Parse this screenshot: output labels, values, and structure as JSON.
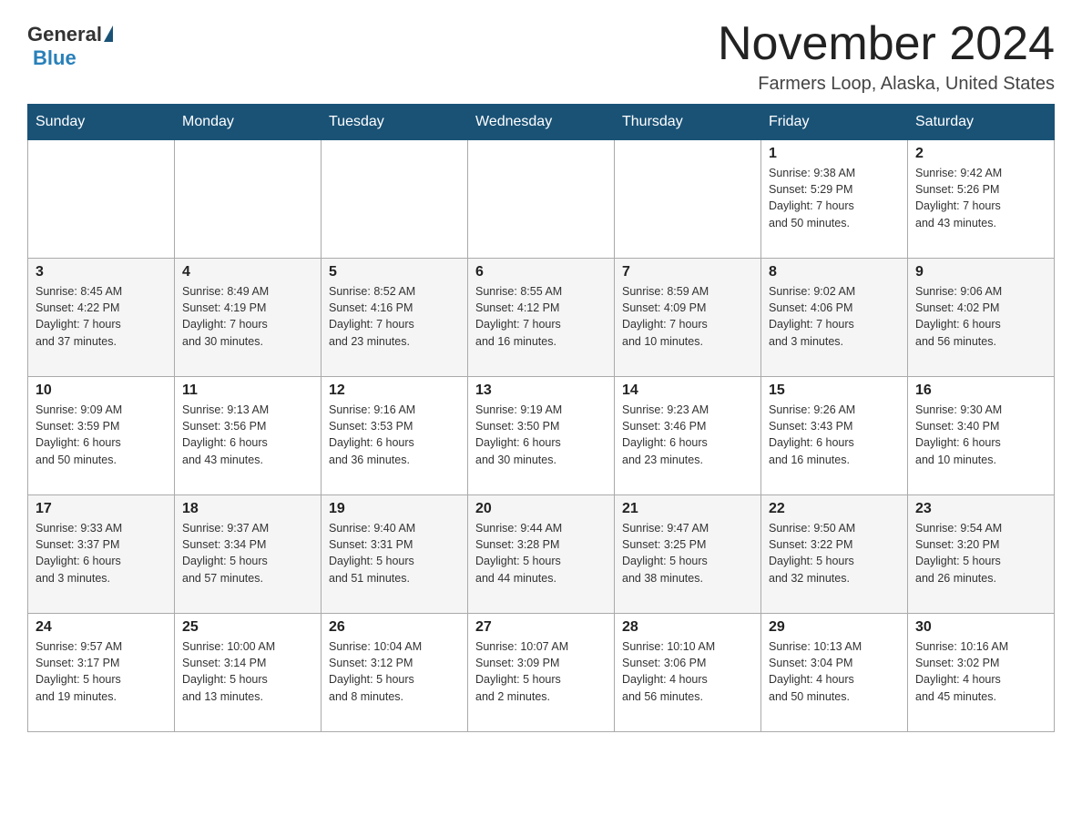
{
  "header": {
    "logo_general": "General",
    "logo_blue": "Blue",
    "title": "November 2024",
    "location": "Farmers Loop, Alaska, United States"
  },
  "days_of_week": [
    "Sunday",
    "Monday",
    "Tuesday",
    "Wednesday",
    "Thursday",
    "Friday",
    "Saturday"
  ],
  "weeks": [
    [
      {
        "day": "",
        "info": ""
      },
      {
        "day": "",
        "info": ""
      },
      {
        "day": "",
        "info": ""
      },
      {
        "day": "",
        "info": ""
      },
      {
        "day": "",
        "info": ""
      },
      {
        "day": "1",
        "info": "Sunrise: 9:38 AM\nSunset: 5:29 PM\nDaylight: 7 hours\nand 50 minutes."
      },
      {
        "day": "2",
        "info": "Sunrise: 9:42 AM\nSunset: 5:26 PM\nDaylight: 7 hours\nand 43 minutes."
      }
    ],
    [
      {
        "day": "3",
        "info": "Sunrise: 8:45 AM\nSunset: 4:22 PM\nDaylight: 7 hours\nand 37 minutes."
      },
      {
        "day": "4",
        "info": "Sunrise: 8:49 AM\nSunset: 4:19 PM\nDaylight: 7 hours\nand 30 minutes."
      },
      {
        "day": "5",
        "info": "Sunrise: 8:52 AM\nSunset: 4:16 PM\nDaylight: 7 hours\nand 23 minutes."
      },
      {
        "day": "6",
        "info": "Sunrise: 8:55 AM\nSunset: 4:12 PM\nDaylight: 7 hours\nand 16 minutes."
      },
      {
        "day": "7",
        "info": "Sunrise: 8:59 AM\nSunset: 4:09 PM\nDaylight: 7 hours\nand 10 minutes."
      },
      {
        "day": "8",
        "info": "Sunrise: 9:02 AM\nSunset: 4:06 PM\nDaylight: 7 hours\nand 3 minutes."
      },
      {
        "day": "9",
        "info": "Sunrise: 9:06 AM\nSunset: 4:02 PM\nDaylight: 6 hours\nand 56 minutes."
      }
    ],
    [
      {
        "day": "10",
        "info": "Sunrise: 9:09 AM\nSunset: 3:59 PM\nDaylight: 6 hours\nand 50 minutes."
      },
      {
        "day": "11",
        "info": "Sunrise: 9:13 AM\nSunset: 3:56 PM\nDaylight: 6 hours\nand 43 minutes."
      },
      {
        "day": "12",
        "info": "Sunrise: 9:16 AM\nSunset: 3:53 PM\nDaylight: 6 hours\nand 36 minutes."
      },
      {
        "day": "13",
        "info": "Sunrise: 9:19 AM\nSunset: 3:50 PM\nDaylight: 6 hours\nand 30 minutes."
      },
      {
        "day": "14",
        "info": "Sunrise: 9:23 AM\nSunset: 3:46 PM\nDaylight: 6 hours\nand 23 minutes."
      },
      {
        "day": "15",
        "info": "Sunrise: 9:26 AM\nSunset: 3:43 PM\nDaylight: 6 hours\nand 16 minutes."
      },
      {
        "day": "16",
        "info": "Sunrise: 9:30 AM\nSunset: 3:40 PM\nDaylight: 6 hours\nand 10 minutes."
      }
    ],
    [
      {
        "day": "17",
        "info": "Sunrise: 9:33 AM\nSunset: 3:37 PM\nDaylight: 6 hours\nand 3 minutes."
      },
      {
        "day": "18",
        "info": "Sunrise: 9:37 AM\nSunset: 3:34 PM\nDaylight: 5 hours\nand 57 minutes."
      },
      {
        "day": "19",
        "info": "Sunrise: 9:40 AM\nSunset: 3:31 PM\nDaylight: 5 hours\nand 51 minutes."
      },
      {
        "day": "20",
        "info": "Sunrise: 9:44 AM\nSunset: 3:28 PM\nDaylight: 5 hours\nand 44 minutes."
      },
      {
        "day": "21",
        "info": "Sunrise: 9:47 AM\nSunset: 3:25 PM\nDaylight: 5 hours\nand 38 minutes."
      },
      {
        "day": "22",
        "info": "Sunrise: 9:50 AM\nSunset: 3:22 PM\nDaylight: 5 hours\nand 32 minutes."
      },
      {
        "day": "23",
        "info": "Sunrise: 9:54 AM\nSunset: 3:20 PM\nDaylight: 5 hours\nand 26 minutes."
      }
    ],
    [
      {
        "day": "24",
        "info": "Sunrise: 9:57 AM\nSunset: 3:17 PM\nDaylight: 5 hours\nand 19 minutes."
      },
      {
        "day": "25",
        "info": "Sunrise: 10:00 AM\nSunset: 3:14 PM\nDaylight: 5 hours\nand 13 minutes."
      },
      {
        "day": "26",
        "info": "Sunrise: 10:04 AM\nSunset: 3:12 PM\nDaylight: 5 hours\nand 8 minutes."
      },
      {
        "day": "27",
        "info": "Sunrise: 10:07 AM\nSunset: 3:09 PM\nDaylight: 5 hours\nand 2 minutes."
      },
      {
        "day": "28",
        "info": "Sunrise: 10:10 AM\nSunset: 3:06 PM\nDaylight: 4 hours\nand 56 minutes."
      },
      {
        "day": "29",
        "info": "Sunrise: 10:13 AM\nSunset: 3:04 PM\nDaylight: 4 hours\nand 50 minutes."
      },
      {
        "day": "30",
        "info": "Sunrise: 10:16 AM\nSunset: 3:02 PM\nDaylight: 4 hours\nand 45 minutes."
      }
    ]
  ]
}
